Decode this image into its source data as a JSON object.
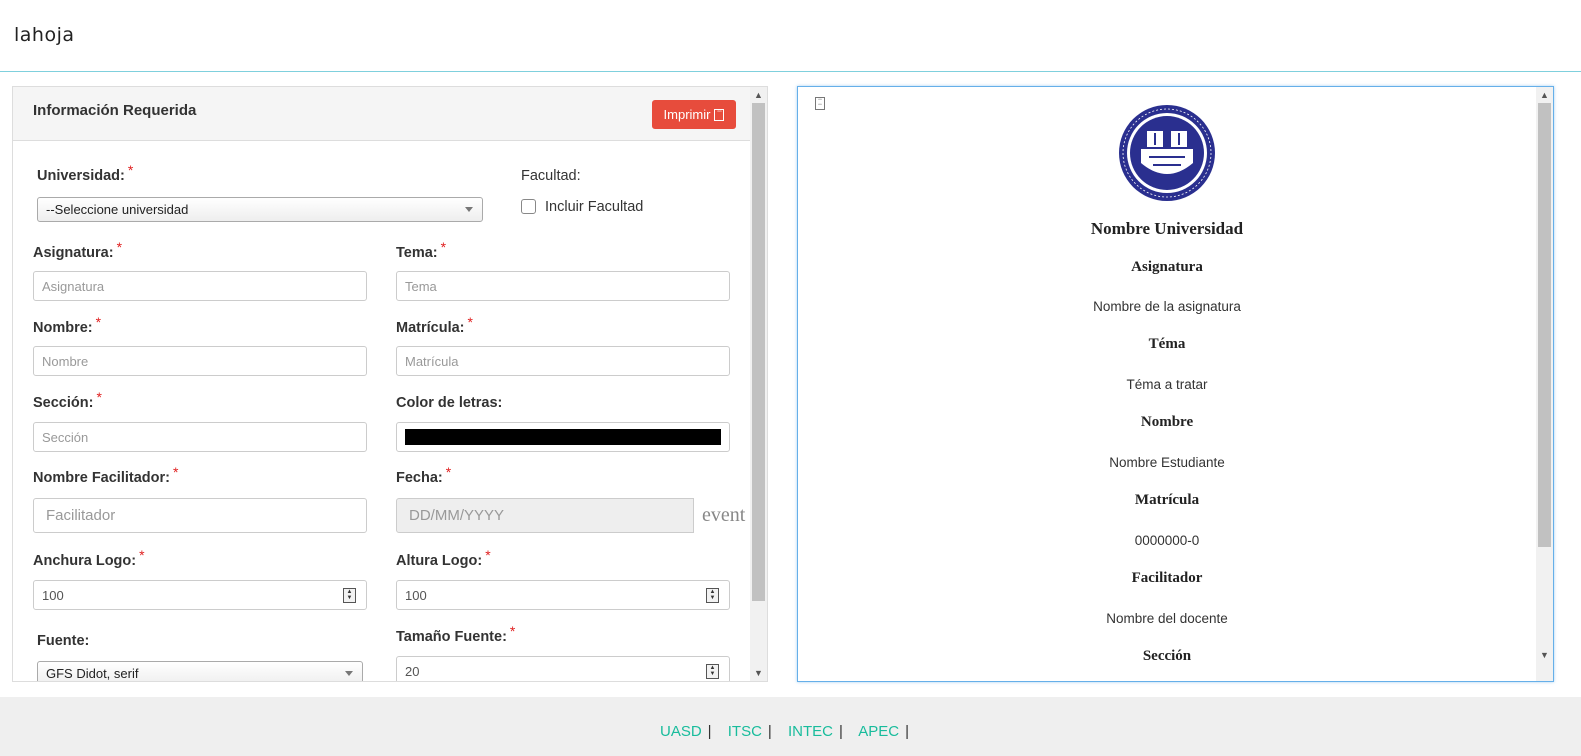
{
  "navbar": {
    "brand": "lahoja"
  },
  "form": {
    "title": "Información Requerida",
    "print_label": "Imprimir",
    "universidad": {
      "label": "Universidad:",
      "selected": "--Seleccione universidad"
    },
    "facultad": {
      "label": "Facultad:",
      "checkbox_label": "Incluir Facultad"
    },
    "asignatura": {
      "label": "Asignatura:",
      "placeholder": "Asignatura"
    },
    "tema": {
      "label": "Tema:",
      "placeholder": "Tema"
    },
    "nombre": {
      "label": "Nombre:",
      "placeholder": "Nombre"
    },
    "matricula": {
      "label": "Matrícula:",
      "placeholder": "Matrícula"
    },
    "seccion": {
      "label": "Sección:",
      "placeholder": "Sección"
    },
    "color_letras": {
      "label": "Color de letras:",
      "value": "#000000"
    },
    "facilitador": {
      "label": "Nombre Facilitador:",
      "placeholder": "Facilitador"
    },
    "fecha": {
      "label": "Fecha:",
      "placeholder": "DD/MM/YYYY",
      "addon": "event"
    },
    "anchura_logo": {
      "label": "Anchura Logo:",
      "value": "100"
    },
    "altura_logo": {
      "label": "Altura Logo:",
      "value": "100"
    },
    "fuente": {
      "label": "Fuente:",
      "selected": "GFS Didot, serif"
    },
    "tamano_fuente": {
      "label": "Tamaño Fuente:",
      "value": "20"
    }
  },
  "preview": {
    "universidad": "Nombre Universidad",
    "asignatura_h": "Asignatura",
    "asignatura_t": "Nombre de la asignatura",
    "tema_h": "Téma",
    "tema_t": "Téma a tratar",
    "nombre_h": "Nombre",
    "nombre_t": "Nombre Estudiante",
    "matricula_h": "Matrícula",
    "matricula_t": "0000000-0",
    "facilitador_h": "Facilitador",
    "facilitador_t": "Nombre del docente",
    "seccion_h": "Sección"
  },
  "footer": {
    "links": [
      "UASD",
      "ITSC",
      "INTEC",
      "APEC"
    ]
  },
  "colors": {
    "accent": "#18bc9c",
    "danger": "#e74c3c",
    "required": "#e02020",
    "seal": "#2a2f8f"
  }
}
